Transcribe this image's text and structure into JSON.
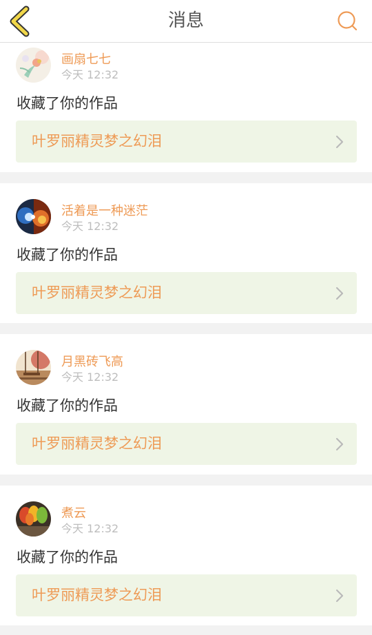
{
  "header": {
    "title": "消息",
    "back_icon": "chevron-left-icon",
    "search_icon": "search-icon"
  },
  "colors": {
    "accent": "#ee9a55",
    "link_bg": "#eff5e6",
    "back_icon_outline": "#333333",
    "back_icon_fill": "#f1d74a"
  },
  "messages": [
    {
      "username": "画扇七七",
      "time": "今天 12:32",
      "action": "收藏了你的作品",
      "work_title": "叶罗丽精灵梦之幻泪",
      "avatar_icon": "avatar-flower-image"
    },
    {
      "username": "活着是一种迷茫",
      "time": "今天 12:32",
      "action": "收藏了你的作品",
      "work_title": "叶罗丽精灵梦之幻泪",
      "avatar_icon": "avatar-fire-ice-image"
    },
    {
      "username": "月黑砖飞高",
      "time": "今天 12:32",
      "action": "收藏了你的作品",
      "work_title": "叶罗丽精灵梦之幻泪",
      "avatar_icon": "avatar-swing-image"
    },
    {
      "username": "煮云",
      "time": "今天 12:32",
      "action": "收藏了你的作品",
      "work_title": "叶罗丽精灵梦之幻泪",
      "avatar_icon": "avatar-leaves-image"
    }
  ]
}
